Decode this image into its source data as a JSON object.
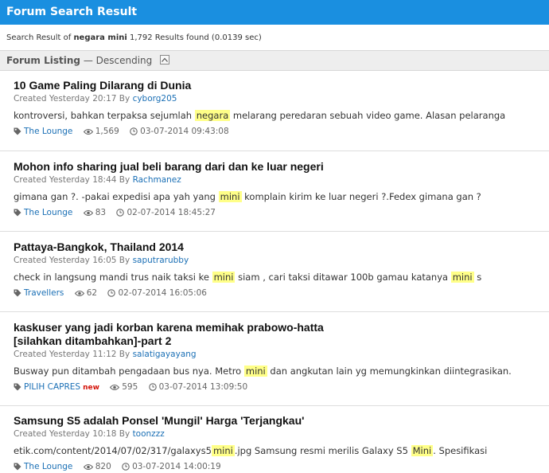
{
  "header": {
    "title": "Forum Search Result"
  },
  "summary": {
    "prefix": "Search Result of ",
    "query": "negara mini",
    "suffix": " 1,792 Results found (0.0139 sec)"
  },
  "listing": {
    "title": "Forum Listing",
    "order": "— Descending"
  },
  "threads": [
    {
      "title": "10 Game Paling Dilarang di Dunia",
      "created": "Created Yesterday 20:17 By ",
      "author": "cyborg205",
      "snippet_a": "kontroversi, bahkan terpaksa sejumlah ",
      "hl1": "negara",
      "snippet_b": " melarang peredaran sebuah video game. Alasan pelaranga",
      "forum": "The Lounge",
      "views": "1,569",
      "date": "03-07-2014 09:43:08"
    },
    {
      "title": "Mohon info sharing jual beli barang dari dan ke luar negeri",
      "created": "Created Yesterday 18:44 By ",
      "author": "Rachmanez",
      "snippet_a": "gimana gan ?. -pakai expedisi apa yah yang ",
      "hl1": "mini",
      "snippet_b": " komplain kirim ke luar negeri ?.Fedex gimana gan ?",
      "forum": "The Lounge",
      "views": "83",
      "date": "02-07-2014 18:45:27"
    },
    {
      "title": "Pattaya-Bangkok, Thailand 2014",
      "created": "Created Yesterday 16:05 By ",
      "author": "saputrarubby",
      "snippet_a": "check in langsung mandi trus naik taksi ke ",
      "hl1": "mini",
      "snippet_b": " siam , cari taksi ditawar 100b gamau katanya ",
      "hl2": "mini",
      "snippet_c": " s",
      "forum": "Travellers",
      "views": "62",
      "date": "02-07-2014 16:05:06"
    },
    {
      "title": "kaskuser yang jadi korban karena memihak prabowo-hatta",
      "title2": "[silahkan ditambahkan]-part 2",
      "created": "Created Yesterday 11:12 By ",
      "author": "salatigayayang",
      "snippet_a": "Busway pun ditambah pengadaan bus nya. Metro ",
      "hl1": "mini",
      "snippet_b": " dan angkutan lain yg memungkinkan diintegrasikan.",
      "forum": "PILIH CAPRES",
      "badge": "new",
      "views": "595",
      "date": "03-07-2014 13:09:50"
    },
    {
      "title": "Samsung S5 adalah Ponsel 'Mungil' Harga 'Terjangkau'",
      "created": "Created Yesterday 10:18 By ",
      "author": "toonzzz",
      "snippet_a": "etik.com/content/2014/07/02/317/galaxys5",
      "hl1": "mini",
      "snippet_b": ".jpg Samsung resmi merilis Galaxy S5 ",
      "hl2": "Mini",
      "snippet_c": ". Spesifikasi",
      "forum": "The Lounge",
      "views": "820",
      "date": "03-07-2014 14:00:19"
    }
  ]
}
